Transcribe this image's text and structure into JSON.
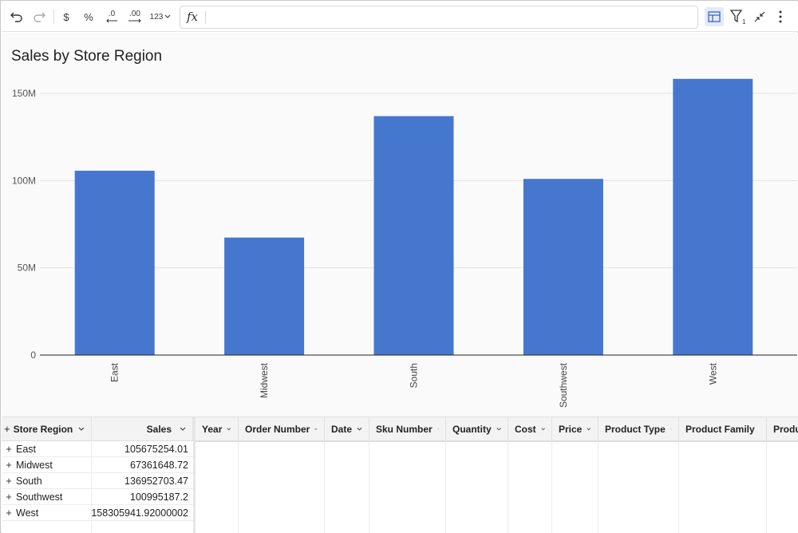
{
  "toolbar": {
    "undo_icon": "undo-icon",
    "redo_icon": "redo-icon",
    "currency_label": "$",
    "percent_label": "%",
    "decrease_decimals_label": ".0",
    "increase_decimals_label": ".00",
    "number_format_label": "123",
    "fx_label": "fx",
    "formula_value": ""
  },
  "chart_data": {
    "type": "bar",
    "title": "Sales by Store Region",
    "categories": [
      "East",
      "Midwest",
      "South",
      "Southwest",
      "West"
    ],
    "values": [
      105675254.01,
      67361648.72,
      136952703.47,
      100995187.2,
      158305941.92000002
    ],
    "yticks": [
      "0",
      "50M",
      "100M",
      "150M"
    ],
    "ytick_values": [
      0,
      50000000,
      100000000,
      150000000
    ],
    "ylim": [
      0,
      160000000
    ],
    "bar_color": "#4677cf",
    "grid": true
  },
  "table": {
    "left_headers": [
      "Store Region",
      "Sales"
    ],
    "rows": [
      {
        "region": "East",
        "sales": "105675254.01"
      },
      {
        "region": "Midwest",
        "sales": "67361648.72"
      },
      {
        "region": "South",
        "sales": "136952703.47"
      },
      {
        "region": "Southwest",
        "sales": "100995187.2"
      },
      {
        "region": "West",
        "sales": "158305941.92000002"
      }
    ],
    "right_headers": [
      "Year",
      "Order Number",
      "Date",
      "Sku Number",
      "Quantity",
      "Cost",
      "Price",
      "Product Type",
      "Product Family",
      "Produc"
    ]
  }
}
